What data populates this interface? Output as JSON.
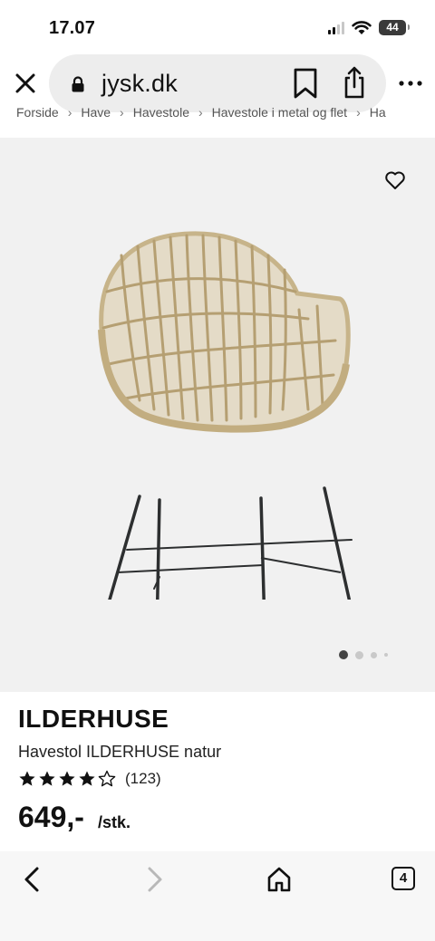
{
  "status": {
    "time": "17.07",
    "battery": "44"
  },
  "browser": {
    "url": "jysk.dk"
  },
  "breadcrumb": [
    "Forside",
    "Have",
    "Havestole",
    "Havestole i metal og flet",
    "Ha"
  ],
  "product": {
    "name": "ILDERHUSE",
    "subtitle": "Havestol ILDERHUSE natur",
    "rating_value": 4,
    "rating_max": 5,
    "rating_count": "(123)",
    "price": "649,-",
    "unit": "/stk."
  },
  "gallery": {
    "image_count": 4,
    "active_index": 0
  },
  "tabs": {
    "count": "4"
  },
  "colors": {
    "gallery_bg": "#f1f1f1",
    "url_pill_bg": "#ededed",
    "text": "#111111"
  },
  "icons": [
    "close-icon",
    "lock-icon",
    "bookmark-icon",
    "share-icon",
    "more-icon",
    "heart-icon",
    "star-icon",
    "back-icon",
    "forward-icon",
    "home-icon",
    "tabs-icon"
  ]
}
